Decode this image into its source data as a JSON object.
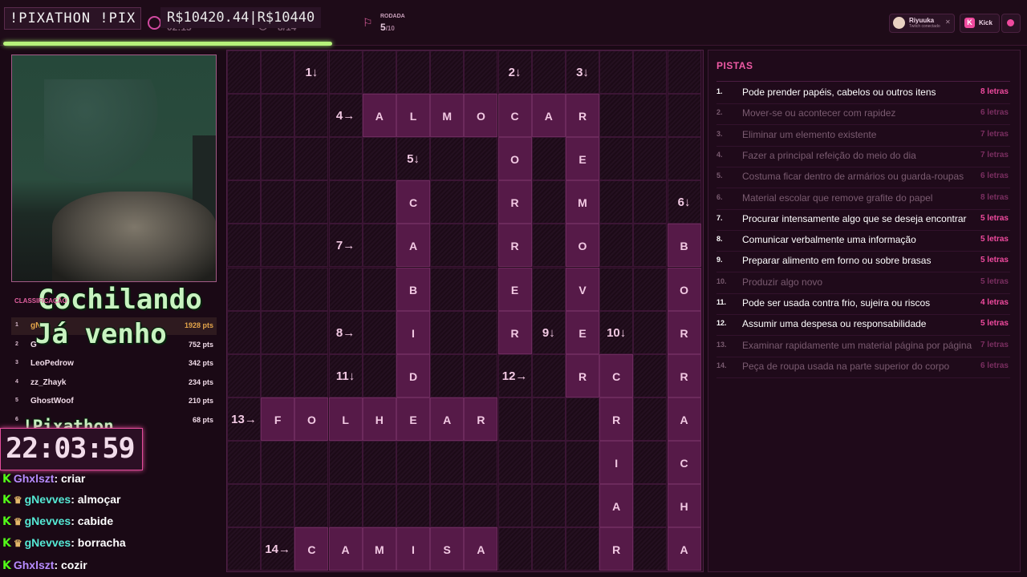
{
  "header": {
    "brand": "!PIXATHON !PIX",
    "money": "R$10420.44|R$10440",
    "timer_under": "02:15",
    "count_under": "8/14",
    "round_label": "RODADA",
    "round_current": "5",
    "round_total": "/10",
    "progress": 0.32,
    "user_name": "Riyuuka",
    "user_sub": "Twitch conectado",
    "kick_label": "Kick"
  },
  "webcam": {
    "overlay_line1": "Cochilando",
    "overlay_line2": "Já venho"
  },
  "leaderboard": {
    "title": "CLASSIFICAÇÃO",
    "rows": [
      {
        "rank": "1",
        "name": "gN",
        "pts": "1928 pts"
      },
      {
        "rank": "2",
        "name": "G",
        "pts": "752 pts"
      },
      {
        "rank": "3",
        "name": "LeoPedrow",
        "pts": "342 pts"
      },
      {
        "rank": "4",
        "name": "zz_Zhayk",
        "pts": "234 pts"
      },
      {
        "rank": "5",
        "name": "GhostWoof",
        "pts": "210 pts"
      },
      {
        "rank": "6",
        "name": "",
        "pts": "68 pts"
      }
    ]
  },
  "overlay_timer": {
    "label": "!Pixathon",
    "time": "22:03:59"
  },
  "chat": [
    {
      "user": "Ghxlszt",
      "msg": ": criar",
      "user_color": "#b78cff",
      "badge": false
    },
    {
      "user": "gNevves",
      "msg": ": almoçar",
      "user_color": "#55e9d5",
      "badge": true
    },
    {
      "user": "gNevves",
      "msg": ": cabide",
      "user_color": "#55e9d5",
      "badge": true
    },
    {
      "user": "gNevves",
      "msg": ": borracha",
      "user_color": "#55e9d5",
      "badge": true
    },
    {
      "user": "Ghxlszt",
      "msg": ": cozir",
      "user_color": "#b78cff",
      "badge": false
    }
  ],
  "grid": {
    "cols": 14,
    "rows": 12,
    "cells": [
      {
        "r": 0,
        "c": 2,
        "n": "1↓"
      },
      {
        "r": 0,
        "c": 8,
        "n": "2↓"
      },
      {
        "r": 0,
        "c": 10,
        "n": "3↓"
      },
      {
        "r": 1,
        "c": 3,
        "n": "4→"
      },
      {
        "r": 1,
        "c": 4,
        "ch": "A"
      },
      {
        "r": 1,
        "c": 5,
        "ch": "L"
      },
      {
        "r": 1,
        "c": 6,
        "ch": "M"
      },
      {
        "r": 1,
        "c": 7,
        "ch": "O"
      },
      {
        "r": 1,
        "c": 8,
        "ch": "C"
      },
      {
        "r": 1,
        "c": 9,
        "ch": "A"
      },
      {
        "r": 1,
        "c": 10,
        "ch": "R"
      },
      {
        "r": 2,
        "c": 5,
        "n": "5↓"
      },
      {
        "r": 2,
        "c": 8,
        "ch": "O"
      },
      {
        "r": 2,
        "c": 10,
        "ch": "E"
      },
      {
        "r": 3,
        "c": 5,
        "ch": "C"
      },
      {
        "r": 3,
        "c": 8,
        "ch": "R"
      },
      {
        "r": 3,
        "c": 10,
        "ch": "M"
      },
      {
        "r": 3,
        "c": 13,
        "n": "6↓"
      },
      {
        "r": 4,
        "c": 3,
        "n": "7→"
      },
      {
        "r": 4,
        "c": 5,
        "ch": "A"
      },
      {
        "r": 4,
        "c": 8,
        "ch": "R"
      },
      {
        "r": 4,
        "c": 10,
        "ch": "O"
      },
      {
        "r": 4,
        "c": 13,
        "ch": "B"
      },
      {
        "r": 5,
        "c": 5,
        "ch": "B"
      },
      {
        "r": 5,
        "c": 8,
        "ch": "E"
      },
      {
        "r": 5,
        "c": 10,
        "ch": "V"
      },
      {
        "r": 5,
        "c": 13,
        "ch": "O"
      },
      {
        "r": 6,
        "c": 3,
        "n": "8→"
      },
      {
        "r": 6,
        "c": 5,
        "ch": "I"
      },
      {
        "r": 6,
        "c": 8,
        "ch": "R"
      },
      {
        "r": 6,
        "c": 9,
        "n": "9↓"
      },
      {
        "r": 6,
        "c": 10,
        "ch": "E"
      },
      {
        "r": 6,
        "c": 11,
        "n": "10↓"
      },
      {
        "r": 6,
        "c": 13,
        "ch": "R"
      },
      {
        "r": 7,
        "c": 3,
        "n": "11↓"
      },
      {
        "r": 7,
        "c": 5,
        "ch": "D"
      },
      {
        "r": 7,
        "c": 8,
        "n": "12→"
      },
      {
        "r": 7,
        "c": 10,
        "ch": "R"
      },
      {
        "r": 7,
        "c": 11,
        "ch": "C"
      },
      {
        "r": 7,
        "c": 13,
        "ch": "R"
      },
      {
        "r": 8,
        "c": 0,
        "n": "13→"
      },
      {
        "r": 8,
        "c": 1,
        "ch": "F"
      },
      {
        "r": 8,
        "c": 2,
        "ch": "O"
      },
      {
        "r": 8,
        "c": 3,
        "ch": "L"
      },
      {
        "r": 8,
        "c": 4,
        "ch": "H"
      },
      {
        "r": 8,
        "c": 5,
        "ch": "E"
      },
      {
        "r": 8,
        "c": 6,
        "ch": "A"
      },
      {
        "r": 8,
        "c": 7,
        "ch": "R"
      },
      {
        "r": 8,
        "c": 11,
        "ch": "R"
      },
      {
        "r": 8,
        "c": 13,
        "ch": "A"
      },
      {
        "r": 9,
        "c": 11,
        "ch": "I"
      },
      {
        "r": 9,
        "c": 13,
        "ch": "C"
      },
      {
        "r": 10,
        "c": 11,
        "ch": "A"
      },
      {
        "r": 10,
        "c": 13,
        "ch": "H"
      },
      {
        "r": 11,
        "c": 1,
        "n": "14→"
      },
      {
        "r": 11,
        "c": 2,
        "ch": "C"
      },
      {
        "r": 11,
        "c": 3,
        "ch": "A"
      },
      {
        "r": 11,
        "c": 4,
        "ch": "M"
      },
      {
        "r": 11,
        "c": 5,
        "ch": "I"
      },
      {
        "r": 11,
        "c": 6,
        "ch": "S"
      },
      {
        "r": 11,
        "c": 7,
        "ch": "A"
      },
      {
        "r": 11,
        "c": 11,
        "ch": "R"
      },
      {
        "r": 11,
        "c": 13,
        "ch": "A"
      }
    ]
  },
  "clues": {
    "title": "PISTAS",
    "items": [
      {
        "num": "1.",
        "text": "Pode prender papéis, cabelos ou outros itens",
        "len": "8 letras",
        "active": true
      },
      {
        "num": "2.",
        "text": "Mover-se ou acontecer com rapidez",
        "len": "6 letras",
        "active": false
      },
      {
        "num": "3.",
        "text": "Eliminar um elemento existente",
        "len": "7 letras",
        "active": false
      },
      {
        "num": "4.",
        "text": "Fazer a principal refeição do meio do dia",
        "len": "7 letras",
        "active": false
      },
      {
        "num": "5.",
        "text": "Costuma ficar dentro de armários ou guarda-roupas",
        "len": "6 letras",
        "active": false
      },
      {
        "num": "6.",
        "text": "Material escolar que remove grafite do papel",
        "len": "8 letras",
        "active": false
      },
      {
        "num": "7.",
        "text": "Procurar intensamente algo que se deseja encontrar",
        "len": "5 letras",
        "active": true
      },
      {
        "num": "8.",
        "text": "Comunicar verbalmente uma informação",
        "len": "5 letras",
        "active": true
      },
      {
        "num": "9.",
        "text": "Preparar alimento em forno ou sobre brasas",
        "len": "5 letras",
        "active": true
      },
      {
        "num": "10.",
        "text": "Produzir algo novo",
        "len": "5 letras",
        "active": false
      },
      {
        "num": "11.",
        "text": "Pode ser usada contra frio, sujeira ou riscos",
        "len": "4 letras",
        "active": true
      },
      {
        "num": "12.",
        "text": "Assumir uma despesa ou responsabilidade",
        "len": "5 letras",
        "active": true
      },
      {
        "num": "13.",
        "text": "Examinar rapidamente um material página por página",
        "len": "7 letras",
        "active": false
      },
      {
        "num": "14.",
        "text": "Peça de roupa usada na parte superior do corpo",
        "len": "6 letras",
        "active": false
      }
    ]
  }
}
